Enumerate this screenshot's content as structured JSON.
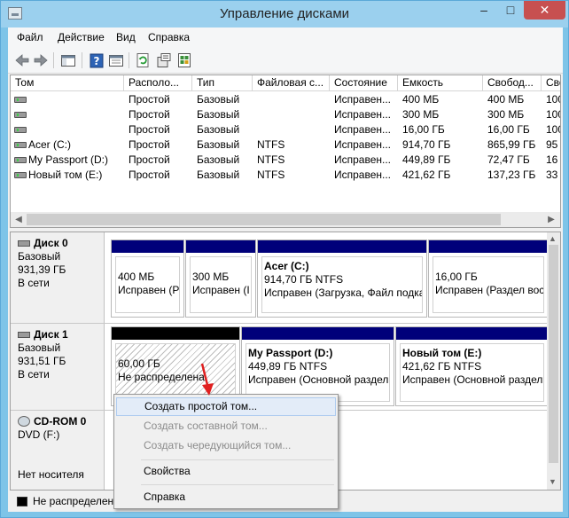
{
  "window": {
    "title": "Управление дисками",
    "min_glyph": "–",
    "max_glyph": "□",
    "close_glyph": "✕"
  },
  "menu": [
    "Файл",
    "Действие",
    "Вид",
    "Справка"
  ],
  "toolbar_icons": [
    "back-arrow-icon",
    "forward-arrow-icon",
    "console-tree-icon",
    "help-icon",
    "show-pane-icon",
    "refresh-icon",
    "properties-icon",
    "rescan-icon"
  ],
  "volume_list": {
    "columns": [
      "Том",
      "Располо...",
      "Тип",
      "Файловая с...",
      "Состояние",
      "Емкость",
      "Свобод...",
      "Сво"
    ],
    "rows": [
      [
        "",
        "Простой",
        "Базовый",
        "",
        "Исправен...",
        "400 МБ",
        "400 МБ",
        "100"
      ],
      [
        "",
        "Простой",
        "Базовый",
        "",
        "Исправен...",
        "300 МБ",
        "300 МБ",
        "100"
      ],
      [
        "",
        "Простой",
        "Базовый",
        "",
        "Исправен...",
        "16,00 ГБ",
        "16,00 ГБ",
        "100"
      ],
      [
        "Acer (C:)",
        "Простой",
        "Базовый",
        "NTFS",
        "Исправен...",
        "914,70 ГБ",
        "865,99 ГБ",
        "95"
      ],
      [
        "My Passport (D:)",
        "Простой",
        "Базовый",
        "NTFS",
        "Исправен...",
        "449,89 ГБ",
        "72,47 ГБ",
        "16"
      ],
      [
        "Новый том (E:)",
        "Простой",
        "Базовый",
        "NTFS",
        "Исправен...",
        "421,62 ГБ",
        "137,23 ГБ",
        "33"
      ]
    ]
  },
  "disks": {
    "disk0": {
      "name": "Диск 0",
      "type": "Базовый",
      "size": "931,39 ГБ",
      "status": "В сети",
      "partitions": [
        {
          "title": "",
          "line1": "400 МБ",
          "line2": "Исправен (Р"
        },
        {
          "title": "",
          "line1": "300 МБ",
          "line2": "Исправен (I"
        },
        {
          "title": "Acer  (C:)",
          "line1": "914,70 ГБ NTFS",
          "line2": "Исправен (Загрузка, Файл подка"
        },
        {
          "title": "",
          "line1": "16,00 ГБ",
          "line2": "Исправен (Раздел восс"
        }
      ]
    },
    "disk1": {
      "name": "Диск 1",
      "type": "Базовый",
      "size": "931,51 ГБ",
      "status": "В сети",
      "partitions": [
        {
          "title": "",
          "line1": "60,00 ГБ",
          "line2": "Не распределена"
        },
        {
          "title": "My Passport  (D:)",
          "line1": "449,89 ГБ NTFS",
          "line2": "Исправен (Основной раздел"
        },
        {
          "title": "Новый том  (E:)",
          "line1": "421,62 ГБ NTFS",
          "line2": "Исправен (Основной раздел"
        }
      ]
    },
    "cdrom0": {
      "name": "CD-ROM 0",
      "type": "DVD (F:)",
      "status": "Нет носителя"
    }
  },
  "legend": {
    "label": "Не распределена"
  },
  "context_menu": {
    "items": [
      {
        "label": "Создать простой том...",
        "enabled": true,
        "highlighted": true
      },
      {
        "label": "Создать составной том...",
        "enabled": false
      },
      {
        "label": "Создать чередующийся том...",
        "enabled": false
      },
      {
        "label": "Свойства",
        "enabled": true
      },
      {
        "label": "Справка",
        "enabled": true
      }
    ]
  },
  "colors": {
    "primary_partition": "#00007a",
    "unallocated": "#000000",
    "annotation_arrow": "#e02020",
    "close_button": "#c75050"
  }
}
